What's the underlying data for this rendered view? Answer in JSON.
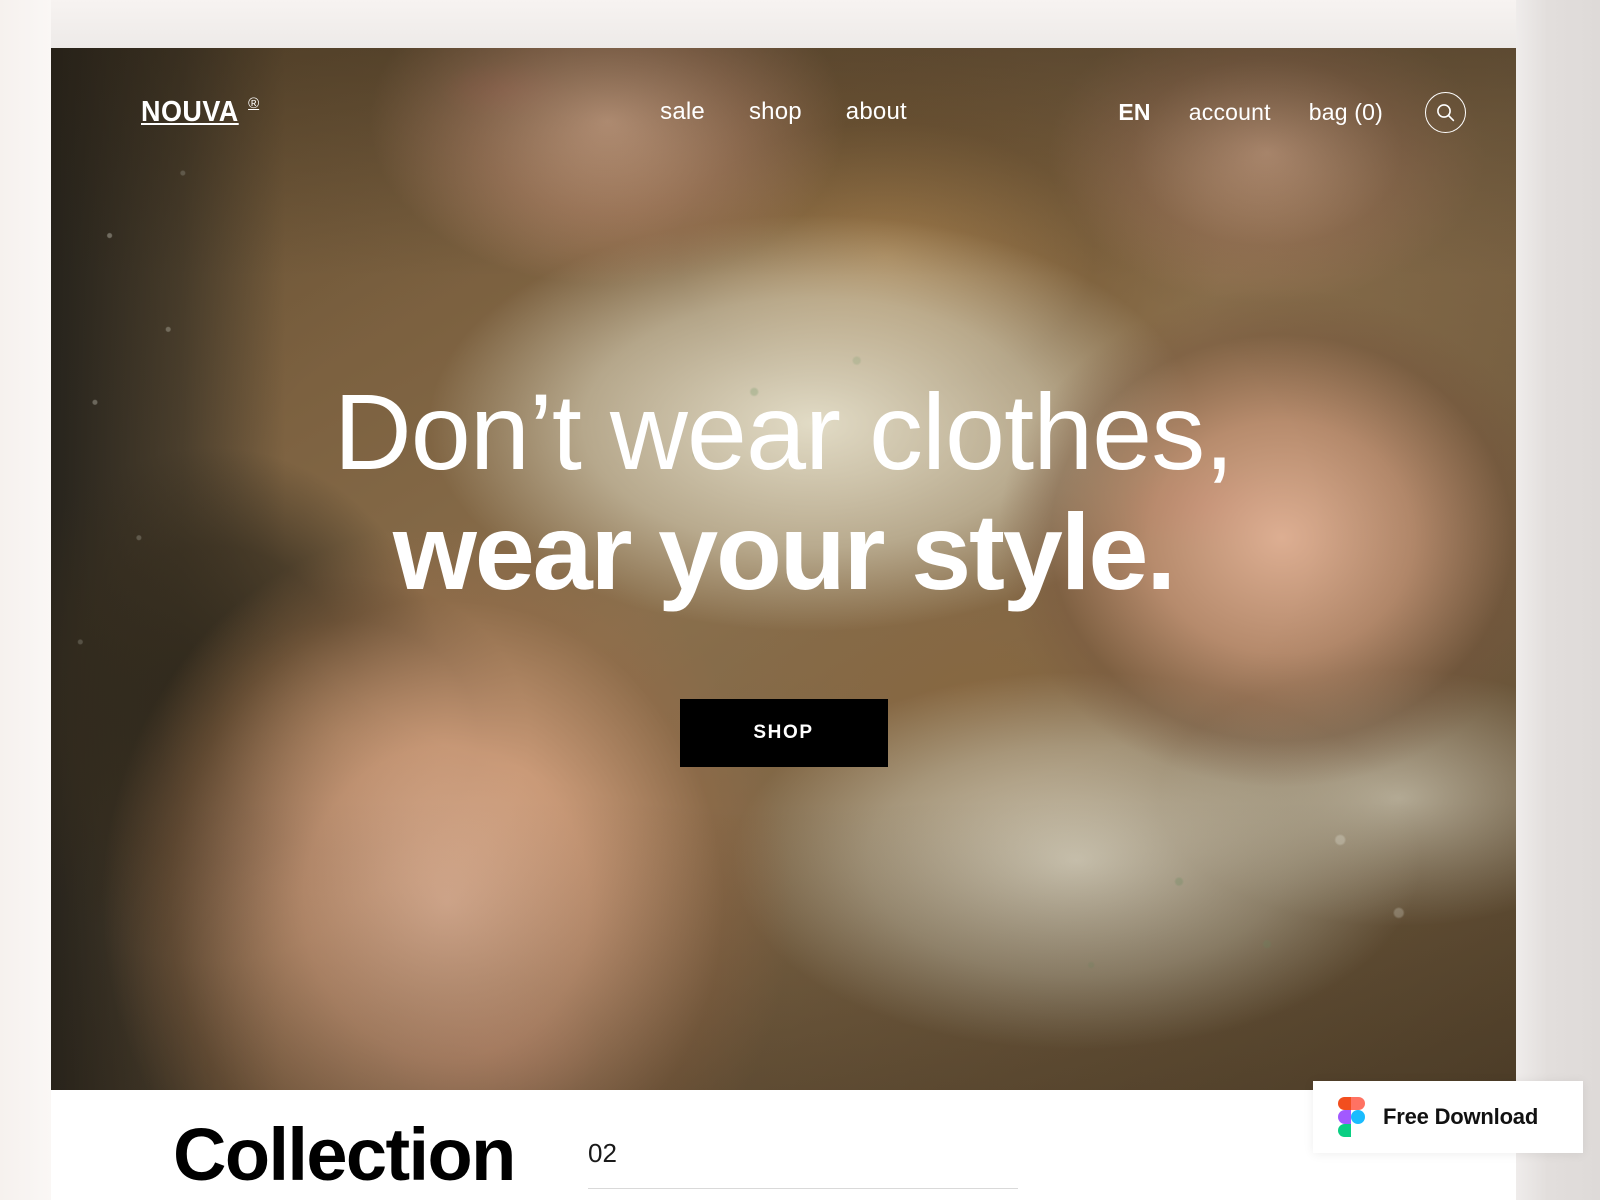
{
  "site": {
    "brand_name": "NOUVA",
    "brand_reg": "®"
  },
  "header": {
    "nav": [
      {
        "label": "sale"
      },
      {
        "label": "shop"
      },
      {
        "label": "about"
      }
    ],
    "language": "EN",
    "account_label": "account",
    "bag_label": "bag (0)",
    "search_icon": "search-icon"
  },
  "hero": {
    "headline_line1": "Don’t wear clothes,",
    "headline_line2": "wear your style.",
    "cta_label": "SHOP"
  },
  "collection": {
    "title": "Collection",
    "index": "02"
  },
  "badge": {
    "label": "Free Download",
    "icon": "figma-logo-icon"
  },
  "colors": {
    "page_background": "#faf6f3",
    "cta_background": "#000000",
    "cta_text": "#ffffff",
    "section_background": "#ffffff",
    "figma_red": "#f24e1e",
    "figma_orange": "#ff7262",
    "figma_purple": "#a259ff",
    "figma_blue": "#1abcfe",
    "figma_green": "#0acf83"
  }
}
